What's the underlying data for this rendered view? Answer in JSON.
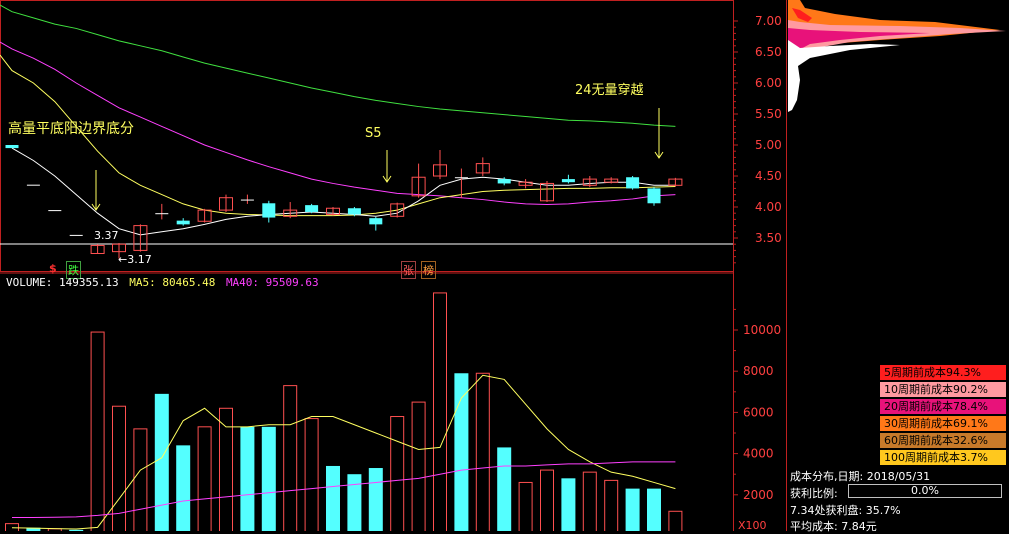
{
  "colors": {
    "background": "#000000",
    "frame": "#c02020",
    "up_candle": "#ff5050",
    "down_candle": "#54ffff",
    "ma_white": "#ffffff",
    "ma_yellow": "#ffff60",
    "ma_magenta": "#ff40ff",
    "ma_green": "#40e040",
    "annotation": "#ffff60"
  },
  "price_axis": {
    "ticks": [
      "7.00",
      "6.50",
      "6.00",
      "5.50",
      "5.00",
      "4.50",
      "4.00",
      "3.50"
    ]
  },
  "annotations": {
    "left": "高量平底阳边界底分",
    "s5": "S5",
    "right": "24无量穿越",
    "low_337": "3.37",
    "low_317": "←3.17"
  },
  "markers": {
    "dollar": "$",
    "die": "跌",
    "zhang": "张",
    "bang": "榜"
  },
  "volume_header": {
    "volume": "VOLUME: 149355.13",
    "ma5": "MA5: 80465.48",
    "ma40": "MA40: 95509.63"
  },
  "volume_axis": {
    "ticks": [
      "10000",
      "8000",
      "6000",
      "4000",
      "2000"
    ],
    "unit": "X100"
  },
  "cost_legend": [
    {
      "label": "5周期前成本94.3%",
      "color": "#ff1e1e"
    },
    {
      "label": "10周期前成本90.2%",
      "color": "#ff9aa0"
    },
    {
      "label": "20周期前成本78.4%",
      "color": "#e8127a"
    },
    {
      "label": "30周期前成本69.1%",
      "color": "#ff7818"
    },
    {
      "label": "60周期前成本32.6%",
      "color": "#c87a2a"
    },
    {
      "label": "100周期前成本3.7%",
      "color": "#ffc81e"
    }
  ],
  "cost_info": {
    "dist_label": "成本分布,日期:",
    "date": "2018/05/31",
    "profit_label": "获利比例:",
    "profit_value": "0.0%",
    "profit_at": "7.34处获利盘: 35.7%",
    "avg_cost": "平均成本: 7.84元"
  },
  "chart_data": [
    {
      "type": "candlestick",
      "ylim": [
        3.3,
        7.2
      ],
      "candles": [
        {
          "o": 5.0,
          "c": 4.95,
          "h": 5.0,
          "l": 4.95
        },
        {
          "o": 4.36,
          "c": 4.36,
          "h": 4.36,
          "l": 4.36
        },
        {
          "o": 3.95,
          "c": 3.95,
          "h": 3.95,
          "l": 3.95
        },
        {
          "o": 3.55,
          "c": 3.55,
          "h": 3.55,
          "l": 3.55
        },
        {
          "o": 3.25,
          "c": 3.38,
          "h": 3.4,
          "l": 3.25
        },
        {
          "o": 3.28,
          "c": 3.4,
          "h": 3.42,
          "l": 3.17
        },
        {
          "o": 3.3,
          "c": 3.7,
          "h": 3.72,
          "l": 3.28
        },
        {
          "o": 3.9,
          "c": 3.9,
          "h": 4.05,
          "l": 3.8
        },
        {
          "o": 3.78,
          "c": 3.72,
          "h": 3.82,
          "l": 3.7
        },
        {
          "o": 3.77,
          "c": 3.95,
          "h": 3.97,
          "l": 3.75
        },
        {
          "o": 3.95,
          "c": 4.15,
          "h": 4.2,
          "l": 3.92
        },
        {
          "o": 4.12,
          "c": 4.12,
          "h": 4.2,
          "l": 4.05
        },
        {
          "o": 4.06,
          "c": 3.83,
          "h": 4.1,
          "l": 3.75
        },
        {
          "o": 3.85,
          "c": 3.95,
          "h": 4.08,
          "l": 3.82
        },
        {
          "o": 4.03,
          "c": 3.92,
          "h": 4.05,
          "l": 3.9
        },
        {
          "o": 3.88,
          "c": 3.98,
          "h": 4.0,
          "l": 3.86
        },
        {
          "o": 3.98,
          "c": 3.88,
          "h": 4.0,
          "l": 3.85
        },
        {
          "o": 3.82,
          "c": 3.72,
          "h": 3.84,
          "l": 3.62
        },
        {
          "o": 3.85,
          "c": 4.05,
          "h": 4.07,
          "l": 3.83
        },
        {
          "o": 4.18,
          "c": 4.48,
          "h": 4.7,
          "l": 4.15
        },
        {
          "o": 4.5,
          "c": 4.68,
          "h": 4.92,
          "l": 4.45
        },
        {
          "o": 4.48,
          "c": 4.48,
          "h": 4.62,
          "l": 4.15
        },
        {
          "o": 4.55,
          "c": 4.7,
          "h": 4.8,
          "l": 4.5
        },
        {
          "o": 4.45,
          "c": 4.38,
          "h": 4.48,
          "l": 4.35
        },
        {
          "o": 4.35,
          "c": 4.4,
          "h": 4.45,
          "l": 4.3
        },
        {
          "o": 4.1,
          "c": 4.38,
          "h": 4.42,
          "l": 4.08
        },
        {
          "o": 4.45,
          "c": 4.4,
          "h": 4.52,
          "l": 4.38
        },
        {
          "o": 4.35,
          "c": 4.45,
          "h": 4.5,
          "l": 4.32
        },
        {
          "o": 4.4,
          "c": 4.45,
          "h": 4.48,
          "l": 4.38
        },
        {
          "o": 4.48,
          "c": 4.3,
          "h": 4.5,
          "l": 4.28
        },
        {
          "o": 4.3,
          "c": 4.06,
          "h": 4.32,
          "l": 4.02
        },
        {
          "o": 4.35,
          "c": 4.45,
          "h": 4.47,
          "l": 4.33
        }
      ],
      "ma_white": [
        4.95,
        4.75,
        4.5,
        4.2,
        3.9,
        3.65,
        3.55,
        3.6,
        3.65,
        3.72,
        3.8,
        3.85,
        3.88,
        3.9,
        3.92,
        3.9,
        3.88,
        3.85,
        3.9,
        4.1,
        4.35,
        4.45,
        4.48,
        4.45,
        4.4,
        4.35,
        4.35,
        4.38,
        4.4,
        4.4,
        4.35,
        4.35
      ],
      "ma_yellow": [
        6.2,
        6.0,
        5.7,
        5.3,
        4.9,
        4.55,
        4.35,
        4.2,
        4.05,
        3.95,
        3.9,
        3.88,
        3.87,
        3.86,
        3.86,
        3.86,
        3.87,
        3.9,
        3.95,
        4.05,
        4.15,
        4.2,
        4.25,
        4.27,
        4.28,
        4.29,
        4.3,
        4.3,
        4.31,
        4.31,
        4.32,
        4.33
      ],
      "ma_magenta": [
        6.55,
        6.4,
        6.22,
        6.0,
        5.8,
        5.6,
        5.45,
        5.3,
        5.15,
        5.0,
        4.88,
        4.76,
        4.65,
        4.55,
        4.45,
        4.38,
        4.32,
        4.27,
        4.22,
        4.2,
        4.18,
        4.15,
        4.12,
        4.08,
        4.05,
        4.04,
        4.05,
        4.08,
        4.1,
        4.13,
        4.18,
        4.2
      ],
      "ma_green": [
        7.15,
        7.05,
        6.95,
        6.88,
        6.78,
        6.68,
        6.6,
        6.52,
        6.42,
        6.32,
        6.24,
        6.16,
        6.08,
        6.0,
        5.92,
        5.85,
        5.78,
        5.72,
        5.67,
        5.62,
        5.58,
        5.55,
        5.52,
        5.49,
        5.46,
        5.43,
        5.4,
        5.39,
        5.37,
        5.35,
        5.32,
        5.3
      ],
      "support_line": 3.35
    },
    {
      "type": "bar",
      "ylim": [
        0,
        12000
      ],
      "volume": [
        600,
        400,
        350,
        300,
        9900,
        6300,
        5200,
        6900,
        4400,
        5300,
        6200,
        5300,
        5300,
        7300,
        5700,
        3400,
        3000,
        3300,
        5800,
        6500,
        11800,
        7900,
        7900,
        4300,
        2600,
        3200,
        2800,
        3100,
        2700,
        2300,
        2300,
        1200
      ],
      "down": [
        false,
        true,
        false,
        true,
        false,
        false,
        false,
        true,
        true,
        false,
        false,
        true,
        true,
        false,
        false,
        true,
        true,
        true,
        false,
        false,
        false,
        true,
        false,
        true,
        false,
        false,
        true,
        false,
        false,
        true,
        true,
        false
      ],
      "ma5": [
        400,
        380,
        360,
        340,
        420,
        1800,
        3200,
        3800,
        5600,
        6200,
        5300,
        5300,
        5400,
        5400,
        5800,
        5800,
        5400,
        5000,
        4600,
        4200,
        4300,
        6700,
        7800,
        7600,
        6400,
        5200,
        4200,
        3600,
        3100,
        2900,
        2600,
        2300
      ],
      "ma40": [
        900,
        900,
        910,
        930,
        1000,
        1100,
        1300,
        1500,
        1700,
        1800,
        1900,
        2000,
        2100,
        2200,
        2300,
        2400,
        2500,
        2600,
        2700,
        2800,
        3000,
        3200,
        3300,
        3400,
        3400,
        3450,
        3500,
        3500,
        3550,
        3600,
        3600,
        3600
      ]
    }
  ]
}
